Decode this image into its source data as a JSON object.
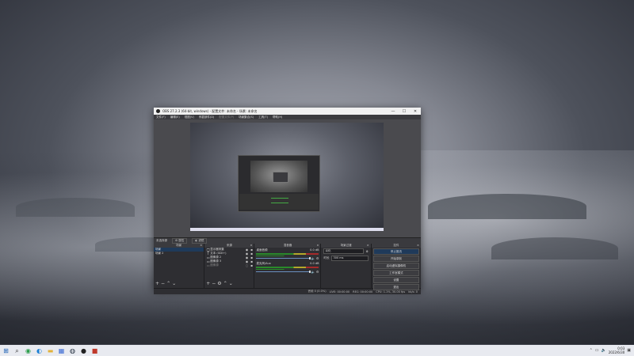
{
  "window": {
    "title": "OBS 27.2.3 (64-bit, windows) - 配置文件: 未命名 - 场景: 未命名",
    "controls": [
      "—",
      "☐",
      "✕"
    ]
  },
  "menu": [
    "文件(F)",
    "编辑(E)",
    "视图(V)",
    "停靠部件(D)",
    "配置文件(P)",
    "场景集合(S)",
    "工具(T)",
    "帮助(H)"
  ],
  "scene_transition": {
    "label": "未选择源",
    "props_label": "属性",
    "filters_label": "滤镜"
  },
  "docks": {
    "scenes": {
      "title": "场景",
      "items": [
        "场景",
        "场景 2"
      ]
    },
    "sources": {
      "title": "来源",
      "items": [
        {
          "icon": "🖵",
          "name": "显示器采集"
        },
        {
          "icon": "T",
          "name": "文本 (GDI+)"
        },
        {
          "icon": "▭",
          "name": "图像源 2"
        },
        {
          "icon": "▭",
          "name": "图像源 3"
        },
        {
          "icon": "▭",
          "name": "图像源"
        }
      ]
    },
    "mixer": {
      "title": "混音器",
      "channels": [
        {
          "name": "桌面音频",
          "db": "0.0 dB"
        },
        {
          "name": "麦克风/Aux",
          "db": "0.0 dB"
        }
      ]
    },
    "transitions": {
      "title": "场景过渡",
      "type": "淡化",
      "duration_label": "时长",
      "duration": "300 ms"
    },
    "controls": {
      "title": "控件",
      "buttons": [
        "停止推流",
        "开始录制",
        "启动虚拟摄像机",
        "工作室模式",
        "设置",
        "退出"
      ]
    }
  },
  "status": {
    "dropped": "丢帧 0 (0.0%)",
    "live": "LIVE: 00:00:00",
    "rec": "REC: 00:00:00",
    "cpu": "CPU: 1.1%, 30.00 fps",
    "kbps": "kb/s: 0"
  },
  "taskbar": {
    "icons": [
      "windows-icon",
      "search-icon",
      "chrome-icon",
      "edge-icon",
      "folder-icon",
      "store-icon",
      "steam-icon",
      "obs-icon",
      "app-icon"
    ],
    "time": "0:03",
    "date": "2022/6/30"
  }
}
